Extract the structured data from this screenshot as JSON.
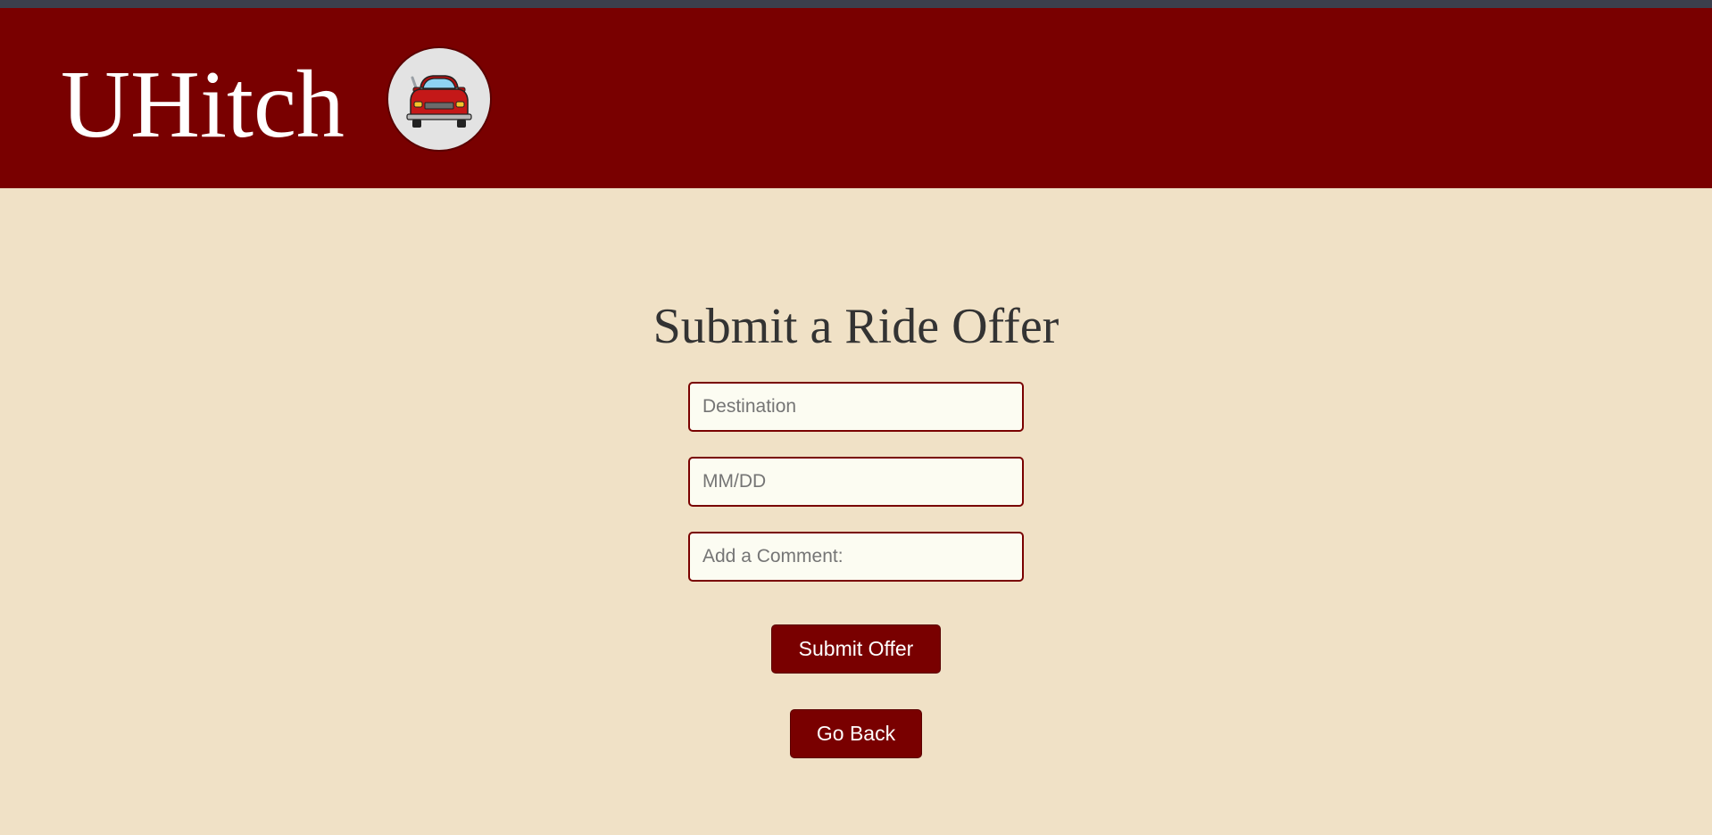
{
  "header": {
    "brand": "UHitch",
    "logo_icon": "car-icon",
    "background": "#790000"
  },
  "main": {
    "title": "Submit a Ride Offer",
    "fields": [
      {
        "placeholder": "Destination",
        "value": ""
      },
      {
        "placeholder": "MM/DD",
        "value": ""
      },
      {
        "placeholder": "Add a Comment:",
        "value": ""
      }
    ],
    "submit_label": "Submit Offer",
    "back_label": "Go Back"
  },
  "colors": {
    "accent": "#790000",
    "page_background": "#f0e1c6",
    "input_background": "#fcfcf2"
  }
}
